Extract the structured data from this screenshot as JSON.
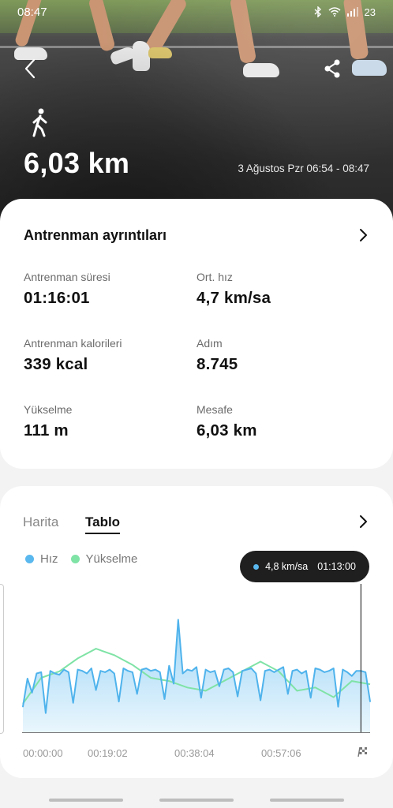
{
  "status_bar": {
    "time": "08:47",
    "battery": "23"
  },
  "hero": {
    "distance": "6,03 km",
    "datetime": "3 Ağustos Pzr 06:54 - 08:47"
  },
  "details": {
    "title": "Antrenman ayrıntıları",
    "metrics": [
      {
        "label": "Antrenman süresi",
        "value": "01:16:01"
      },
      {
        "label": "Ort. hız",
        "value": "4,7 km/sa"
      },
      {
        "label": "Antrenman kalorileri",
        "value": "339 kcal"
      },
      {
        "label": "Adım",
        "value": "8.745"
      },
      {
        "label": "Yükselme",
        "value": "111 m"
      },
      {
        "label": "Mesafe",
        "value": "6,03 km"
      }
    ]
  },
  "chart_section": {
    "tabs": [
      "Harita",
      "Tablo"
    ],
    "selected_tab": "Tablo",
    "legend": [
      {
        "name": "Hız",
        "color": "#5ab8ee"
      },
      {
        "name": "Yükselme",
        "color": "#7fe3a6"
      }
    ],
    "tooltip": {
      "value": "4,8 km/sa",
      "time": "01:13:00"
    },
    "x_ticks": [
      "00:00:00",
      "00:19:02",
      "00:38:04",
      "00:57:06"
    ]
  },
  "chart_data": {
    "type": "area",
    "x_unit": "minutes",
    "x_range": [
      0,
      76
    ],
    "series": [
      {
        "name": "Hız",
        "unit": "km/sa",
        "x": [
          0,
          1,
          2,
          3,
          4,
          5,
          6,
          7,
          8,
          9,
          10,
          11,
          12,
          13,
          14,
          15,
          16,
          17,
          18,
          19,
          20,
          21,
          22,
          23,
          24,
          25,
          26,
          27,
          28,
          29,
          30,
          31,
          32,
          33,
          34,
          35,
          36,
          37,
          38,
          39,
          40,
          41,
          42,
          43,
          44,
          45,
          46,
          47,
          48,
          49,
          50,
          51,
          52,
          53,
          54,
          55,
          56,
          57,
          58,
          59,
          60,
          61,
          62,
          63,
          64,
          65,
          66,
          67,
          68,
          69,
          70,
          71,
          72,
          73,
          74,
          75,
          76
        ],
        "values": [
          2.0,
          4.2,
          3.1,
          4.6,
          4.7,
          1.5,
          4.8,
          4.6,
          4.5,
          4.9,
          4.7,
          2.3,
          4.9,
          4.8,
          4.6,
          5.0,
          3.3,
          4.8,
          4.7,
          4.9,
          4.6,
          2.4,
          5.0,
          4.8,
          4.7,
          3.0,
          4.9,
          5.0,
          4.8,
          4.9,
          4.7,
          2.6,
          5.2,
          3.8,
          8.8,
          4.6,
          4.9,
          4.8,
          5.1,
          2.7,
          4.9,
          4.7,
          4.8,
          3.6,
          4.9,
          5.0,
          4.7,
          2.8,
          4.8,
          4.9,
          5.0,
          4.6,
          2.5,
          4.8,
          4.9,
          4.7,
          4.9,
          5.1,
          3.0,
          4.8,
          4.9,
          4.6,
          4.8,
          2.7,
          5.0,
          4.9,
          4.7,
          4.8,
          5.0,
          2.0,
          4.9,
          4.7,
          4.4,
          4.8,
          4.8,
          4.7,
          2.4
        ]
      },
      {
        "name": "Yükselme",
        "x": [
          0,
          4,
          8,
          12,
          16,
          20,
          24,
          28,
          32,
          36,
          40,
          44,
          48,
          52,
          56,
          60,
          64,
          68,
          72,
          76
        ],
        "values": [
          0.1,
          0.5,
          0.6,
          0.8,
          0.95,
          0.85,
          0.7,
          0.5,
          0.45,
          0.35,
          0.3,
          0.45,
          0.6,
          0.75,
          0.6,
          0.3,
          0.35,
          0.2,
          0.45,
          0.4
        ]
      }
    ],
    "ylim": [
      0,
      10
    ],
    "legend": "top-left",
    "grid": false
  }
}
